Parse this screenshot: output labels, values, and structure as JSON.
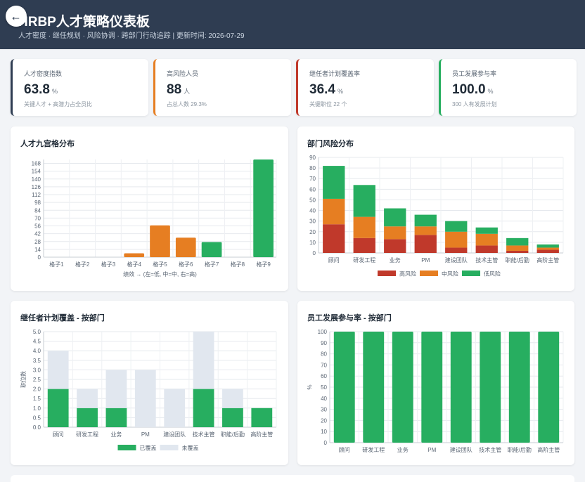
{
  "header": {
    "title": "HRBP人才策略仪表板",
    "subtitle": "人才密度 · 继任规划 · 风险协调 · 跨部门行动追踪 | 更新时间: 2026-07-29",
    "back_icon": "arrow-left-icon"
  },
  "kpis": [
    {
      "label": "人才密度指数",
      "value": "63.8",
      "unit": "%",
      "note": "关键人才 + 高潜力占全员比",
      "color": "#2f3d52"
    },
    {
      "label": "高风险人员",
      "value": "88",
      "unit": "人",
      "note": "占总人数 29.3%",
      "color": "#e67e22"
    },
    {
      "label": "继任者计划覆盖率",
      "value": "36.4",
      "unit": "%",
      "note": "关键职位 22 个",
      "color": "#c0392b"
    },
    {
      "label": "员工发展参与率",
      "value": "100.0",
      "unit": "%",
      "note": "300 人有发展计划",
      "color": "#27ae60"
    }
  ],
  "chart_data": [
    {
      "id": "ninebox",
      "type": "bar",
      "title": "人才九宫格分布",
      "categories": [
        "格子1",
        "格子2",
        "格子3",
        "格子4",
        "格子5",
        "格子6",
        "格子7",
        "格子8",
        "格子9"
      ],
      "values": [
        0,
        0,
        0,
        7,
        57,
        35,
        27,
        0,
        175
      ],
      "colors": [
        "#e67e22",
        "#e67e22",
        "#e67e22",
        "#e67e22",
        "#e67e22",
        "#e67e22",
        "#27ae60",
        "#27ae60",
        "#27ae60"
      ],
      "ylim": [
        0,
        175
      ],
      "yticks": [
        0,
        14,
        28,
        42,
        56,
        70,
        84,
        98,
        112,
        126,
        140,
        154,
        168
      ],
      "xlabel": "绩效 → (左=低, 中=中, 右=高)",
      "grid": true
    },
    {
      "id": "dept-risk",
      "type": "bar",
      "stacked": true,
      "title": "部门风险分布",
      "categories": [
        "顾问",
        "研发工程",
        "业务",
        "PM",
        "建设团队",
        "技术主管",
        "职能/后勤",
        "高阶主管"
      ],
      "series": [
        {
          "name": "高风险",
          "color": "#c0392b",
          "values": [
            27,
            14,
            13,
            17,
            5,
            7,
            2,
            3
          ]
        },
        {
          "name": "中风险",
          "color": "#e67e22",
          "values": [
            24,
            20,
            12,
            8,
            15,
            11,
            5,
            2
          ]
        },
        {
          "name": "低风险",
          "color": "#27ae60",
          "values": [
            31,
            30,
            17,
            11,
            10,
            6,
            7,
            3
          ]
        }
      ],
      "ylim": [
        0,
        90
      ],
      "yticks": [
        0,
        10,
        20,
        30,
        40,
        50,
        60,
        70,
        80,
        90
      ],
      "legend": "bottom",
      "grid": true
    },
    {
      "id": "succession",
      "type": "bar",
      "stacked": true,
      "title": "继任者计划覆盖 - 按部门",
      "categories": [
        "顾问",
        "研发工程",
        "业务",
        "PM",
        "建设团队",
        "技术主管",
        "职能/后勤",
        "高阶主管"
      ],
      "series": [
        {
          "name": "已覆盖",
          "color": "#27ae60",
          "values": [
            2,
            1,
            1,
            0,
            0,
            2,
            1,
            1
          ]
        },
        {
          "name": "未覆盖",
          "color": "#e1e7ef",
          "values": [
            2,
            1,
            2,
            3,
            2,
            3,
            1,
            0
          ]
        }
      ],
      "ylim": [
        0,
        5
      ],
      "yticks": [
        0,
        0.5,
        1.0,
        1.5,
        2.0,
        2.5,
        3.0,
        3.5,
        4.0,
        4.5,
        5.0
      ],
      "ylabel": "职位数",
      "legend": "bottom",
      "grid": true
    },
    {
      "id": "dev-rate",
      "type": "bar",
      "title": "员工发展参与率 - 按部门",
      "categories": [
        "顾问",
        "研发工程",
        "业务",
        "PM",
        "建设团队",
        "技术主管",
        "职能/后勤",
        "高阶主管"
      ],
      "values": [
        100,
        100,
        100,
        100,
        100,
        100,
        100,
        100
      ],
      "color": "#27ae60",
      "ylim": [
        0,
        100
      ],
      "yticks": [
        0,
        10,
        20,
        30,
        40,
        50,
        60,
        70,
        80,
        90,
        100
      ],
      "ylabel": "%",
      "grid": true
    }
  ]
}
